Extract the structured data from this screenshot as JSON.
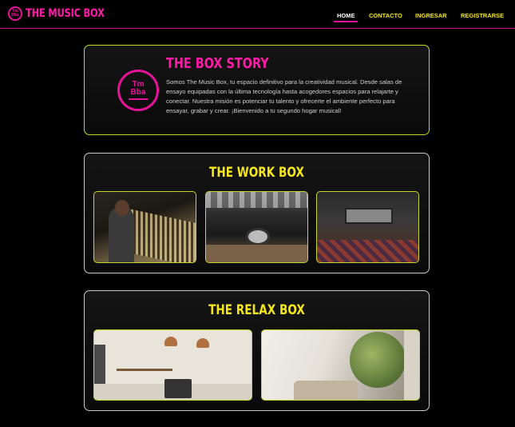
{
  "navbar": {
    "brand": "THE MUSIC BOX",
    "brand_logo_text": "Tm Bba",
    "links": [
      {
        "label": "HOME",
        "active": true
      },
      {
        "label": "CONTACTO",
        "active": false
      },
      {
        "label": "INGRESAR",
        "active": false
      },
      {
        "label": "REGISTRARSE",
        "active": false
      }
    ]
  },
  "story": {
    "title": "THE BOX STORY",
    "logo_text": "Tm Bba",
    "text": "Somos The Music Box, tu espacio definitivo para la creatividad musical. Desde salas de ensayo equipadas con la última tecnología hasta acogedores espacios para relajarte y conectar. Nuestra misión es potenciar tu talento y ofrecerte el ambiente perfecto para ensayar, grabar y crear. ¡Bienvenido a tu segundo hogar musical!"
  },
  "work": {
    "title": "THE WORK BOX"
  },
  "relax": {
    "title": "THE RELAX BOX"
  },
  "colors": {
    "pink": "#ff1aa8",
    "yellow": "#f5e61b",
    "lime_border": "#c6d62a",
    "background": "#000000"
  }
}
